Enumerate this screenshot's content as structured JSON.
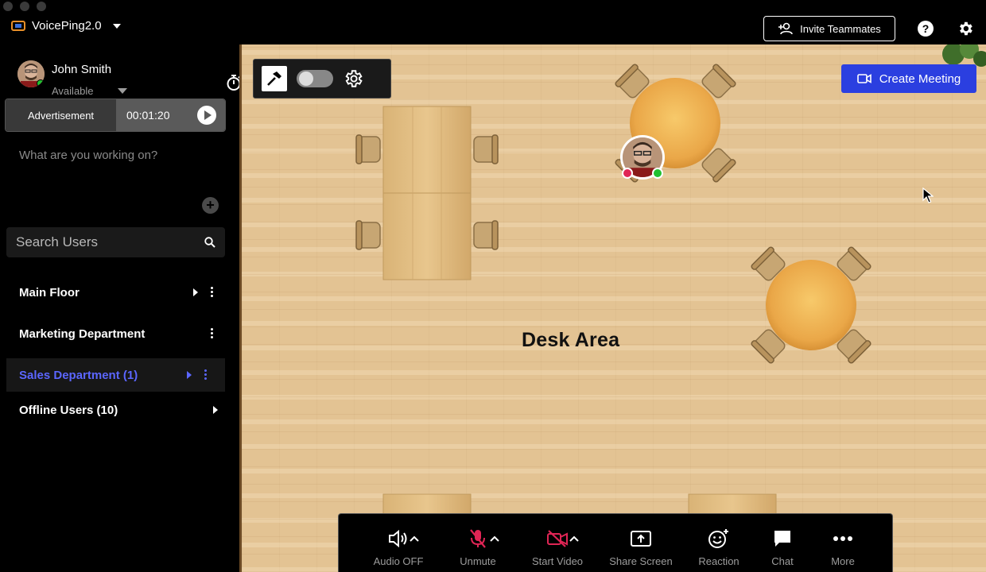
{
  "app": {
    "title": "VoicePing2.0"
  },
  "header": {
    "invite_label": "Invite Teammates",
    "help_label": "?"
  },
  "user": {
    "name": "John Smith",
    "status": "Available"
  },
  "advertisement": {
    "label": "Advertisement",
    "time": "00:01:20"
  },
  "working_on": {
    "placeholder": "What are you working on?"
  },
  "search": {
    "placeholder": "Search Users"
  },
  "rooms": [
    {
      "label": "Main Floor"
    },
    {
      "label": "Marketing Department"
    },
    {
      "label": "Sales Department (1)"
    },
    {
      "label": "Offline Users (10)"
    }
  ],
  "map": {
    "area_label": "Desk Area",
    "create_meeting_label": "Create Meeting"
  },
  "controls": [
    {
      "label": "Audio OFF",
      "icon": "speaker-icon"
    },
    {
      "label": "Unmute",
      "icon": "mic-off-icon"
    },
    {
      "label": "Start Video",
      "icon": "video-off-icon"
    },
    {
      "label": "Share Screen",
      "icon": "share-screen-icon"
    },
    {
      "label": "Reaction",
      "icon": "reaction-icon"
    },
    {
      "label": "Chat",
      "icon": "chat-icon"
    },
    {
      "label": "More",
      "icon": "more-icon"
    }
  ],
  "colors": {
    "accent": "#2b3fe0",
    "active_room": "#5b66ff",
    "muted_red": "#e02555",
    "online_green": "#20c030",
    "floor": "#e3c393"
  }
}
